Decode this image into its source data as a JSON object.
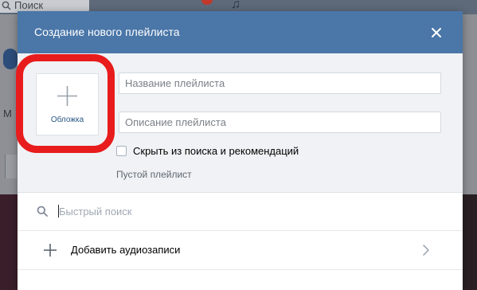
{
  "background": {
    "search_label": "Поиск",
    "sidebar_letter": "М"
  },
  "modal": {
    "title": "Создание нового плейлиста",
    "close_icon": "close-icon",
    "cover": {
      "label": "Обложка",
      "icon": "plus-icon"
    },
    "title_field": {
      "value": "",
      "placeholder": "Название плейлиста"
    },
    "description_field": {
      "value": "",
      "placeholder": "Описание плейлиста"
    },
    "hide_checkbox": {
      "label": "Скрыть из поиска и рекомендаций",
      "checked": false
    },
    "empty_label": "Пустой плейлист",
    "search": {
      "value": "",
      "placeholder": "Быстрый поиск",
      "icon": "search-icon"
    },
    "add_audio": {
      "label": "Добавить аудиозаписи",
      "icon": "plus-icon",
      "chevron": "chevron-right-icon"
    }
  },
  "colors": {
    "header": "#4a76a8",
    "highlight": "#e81c1c",
    "link": "#2a5885"
  }
}
